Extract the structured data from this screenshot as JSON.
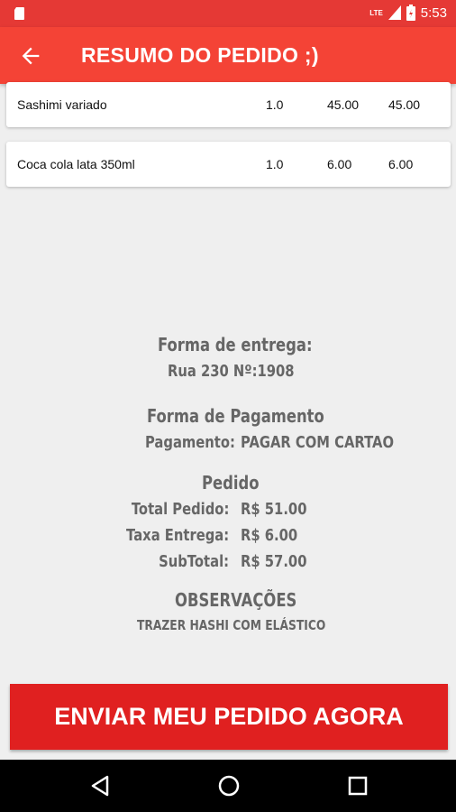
{
  "status_bar": {
    "time": "5:53",
    "network": "LTE",
    "icons": [
      "sd-card-icon",
      "signal-icon",
      "battery-icon"
    ]
  },
  "app_bar": {
    "title": "RESUMO DO PEDIDO ;)",
    "back_icon": "arrow-left-icon"
  },
  "items": [
    {
      "name": "Sashimi variado",
      "qty": "1.0",
      "price": "45.00",
      "total": "45.00"
    },
    {
      "name": "Coca cola lata 350ml",
      "qty": "1.0",
      "price": "6.00",
      "total": "6.00"
    }
  ],
  "delivery": {
    "heading": "Forma de entrega:",
    "address": "Rua 230 Nº:1908"
  },
  "payment": {
    "heading": "Forma de Pagamento",
    "label": "Pagamento:",
    "value": "PAGAR COM CARTAO"
  },
  "order": {
    "heading": "Pedido",
    "total_label": "Total Pedido:",
    "total_value": "R$ 51.00",
    "fee_label": "Taxa Entrega:",
    "fee_value": "R$ 6.00",
    "subtotal_label": "SubTotal:",
    "subtotal_value": "R$ 57.00"
  },
  "notes": {
    "heading": "OBSERVAÇÕES",
    "text": "TRAZER HASHI COM ELÁSTICO"
  },
  "submit_label": "ENVIAR MEU PEDIDO AGORA",
  "colors": {
    "app_bar": "#f44336",
    "status_bar": "#e53935",
    "button": "#e02020"
  }
}
